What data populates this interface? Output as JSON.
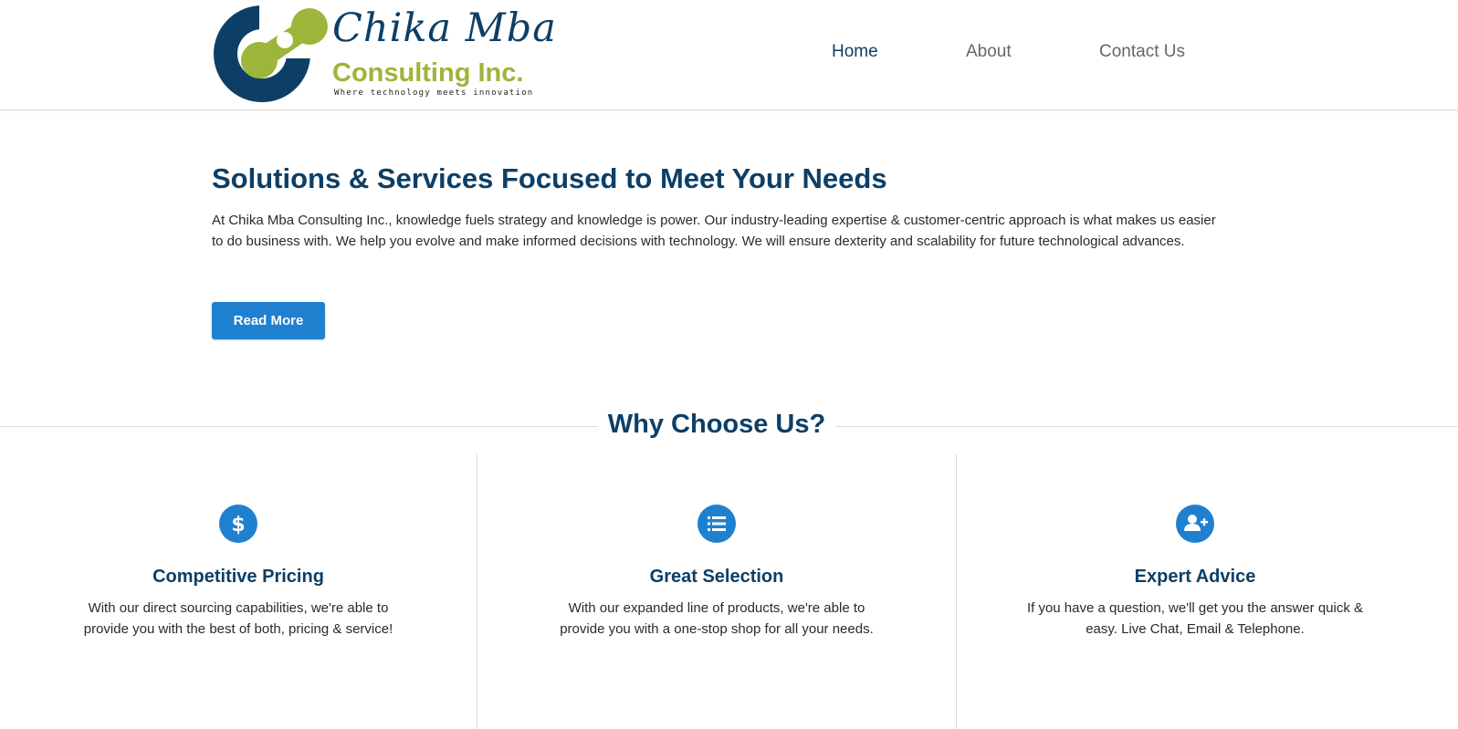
{
  "header": {
    "logo": {
      "script_name": "Chika Mba",
      "company": "Consulting Inc.",
      "tagline": "Where technology meets innovation"
    },
    "nav": [
      {
        "label": "Home",
        "active": true
      },
      {
        "label": "About",
        "active": false
      },
      {
        "label": "Contact Us",
        "active": false
      }
    ]
  },
  "hero": {
    "title": "Solutions & Services Focused to Meet Your Needs",
    "text": "At Chika Mba Consulting Inc., knowledge fuels strategy and knowledge is power. Our industry-leading expertise & customer-centric approach is what makes us easier to do business with. We help you evolve and make informed decisions with technology. We will ensure dexterity and scalability for future technological advances.",
    "button_label": "Read More"
  },
  "why": {
    "title": "Why Choose Us?",
    "features": [
      {
        "icon": "dollar-icon",
        "title": "Competitive Pricing",
        "text": "With our direct sourcing capabilities, we're able to provide you with the best of both, pricing & service!"
      },
      {
        "icon": "list-icon",
        "title": "Great Selection",
        "text": "With our expanded line of products, we're able to provide you with a one-stop shop for all your needs."
      },
      {
        "icon": "user-plus-icon",
        "title": "Expert Advice",
        "text": "If you have a question, we'll get you the answer quick & easy. Live Chat, Email & Telephone."
      }
    ]
  },
  "colors": {
    "navy": "#0d3f66",
    "accent_blue": "#2080d0",
    "logo_green": "#9db53a",
    "nav_inactive": "#666666"
  }
}
